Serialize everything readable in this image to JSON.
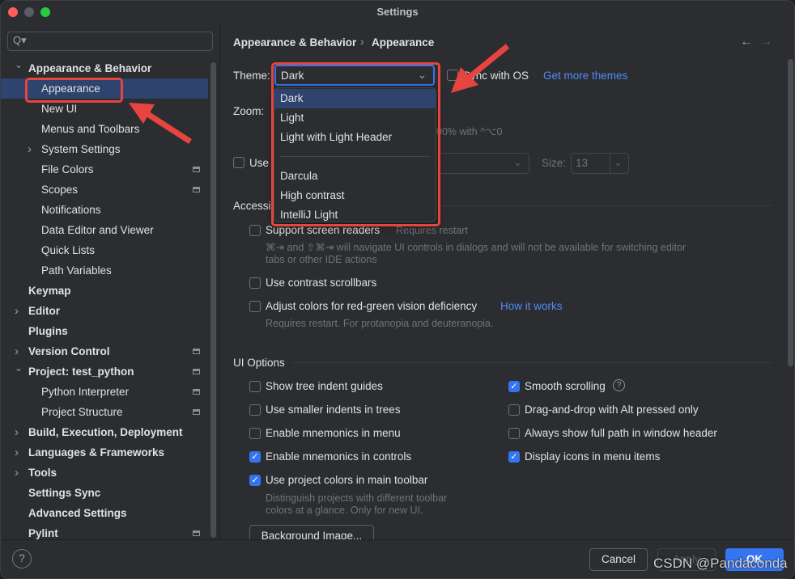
{
  "window": {
    "title": "Settings"
  },
  "sidebar": {
    "search_placeholder": "Q▾",
    "items": [
      {
        "label": "Appearance & Behavior",
        "level": 0,
        "bold": true,
        "arrow": "expanded"
      },
      {
        "label": "Appearance",
        "level": 1,
        "selected": true
      },
      {
        "label": "New UI",
        "level": 1
      },
      {
        "label": "Menus and Toolbars",
        "level": 1
      },
      {
        "label": "System Settings",
        "level": 1,
        "arrow": "collapsed"
      },
      {
        "label": "File Colors",
        "level": 1,
        "badge": true
      },
      {
        "label": "Scopes",
        "level": 1,
        "badge": true
      },
      {
        "label": "Notifications",
        "level": 1
      },
      {
        "label": "Data Editor and Viewer",
        "level": 1
      },
      {
        "label": "Quick Lists",
        "level": 1
      },
      {
        "label": "Path Variables",
        "level": 1
      },
      {
        "label": "Keymap",
        "level": 0,
        "bold": true
      },
      {
        "label": "Editor",
        "level": 0,
        "bold": true,
        "arrow": "collapsed"
      },
      {
        "label": "Plugins",
        "level": 0,
        "bold": true
      },
      {
        "label": "Version Control",
        "level": 0,
        "bold": true,
        "arrow": "collapsed",
        "badge": true
      },
      {
        "label": "Project: test_python",
        "level": 0,
        "bold": true,
        "arrow": "expanded",
        "badge": true
      },
      {
        "label": "Python Interpreter",
        "level": 1,
        "badge": true
      },
      {
        "label": "Project Structure",
        "level": 1,
        "badge": true
      },
      {
        "label": "Build, Execution, Deployment",
        "level": 0,
        "bold": true,
        "arrow": "collapsed"
      },
      {
        "label": "Languages & Frameworks",
        "level": 0,
        "bold": true,
        "arrow": "collapsed"
      },
      {
        "label": "Tools",
        "level": 0,
        "bold": true,
        "arrow": "collapsed"
      },
      {
        "label": "Settings Sync",
        "level": 0,
        "bold": true
      },
      {
        "label": "Advanced Settings",
        "level": 0,
        "bold": true
      },
      {
        "label": "Pylint",
        "level": 0,
        "bold": true,
        "badge": true
      }
    ]
  },
  "breadcrumb": {
    "parent": "Appearance & Behavior",
    "sep": "›",
    "current": "Appearance",
    "back": "←",
    "forward": "→"
  },
  "theme": {
    "label": "Theme:",
    "value": "Dark",
    "sync_label": "Sync with OS",
    "get_more": "Get more themes",
    "options_group1": [
      "Dark",
      "Light",
      "Light with Light Header"
    ],
    "options_group2": [
      "Darcula",
      "High contrast",
      "IntelliJ Light"
    ]
  },
  "zoom": {
    "label": "Zoom:",
    "hint": "00% with ^⌥0"
  },
  "font": {
    "use_label": "Use",
    "size_label": "Size:",
    "size_value": "13"
  },
  "accessibility": {
    "heading": "Accessibility",
    "screen_readers": "Support screen readers",
    "screen_readers_note": "Requires restart",
    "screen_readers_desc1": "⌘⇥ and ⇧⌘⇥ will navigate UI controls in dialogs and will not be available for switching editor",
    "screen_readers_desc2": "tabs or other IDE actions",
    "contrast_scrollbars": "Use contrast scrollbars",
    "red_green": "Adjust colors for red-green vision deficiency",
    "how_it_works": "How it works",
    "red_green_desc": "Requires restart. For protanopia and deuteranopia."
  },
  "ui_options": {
    "heading": "UI Options",
    "left": [
      {
        "label": "Show tree indent guides",
        "checked": false
      },
      {
        "label": "Use smaller indents in trees",
        "checked": false
      },
      {
        "label": "Enable mnemonics in menu",
        "checked": false
      },
      {
        "label": "Enable mnemonics in controls",
        "checked": true
      },
      {
        "label": "Use project colors in main toolbar",
        "checked": true
      }
    ],
    "right": [
      {
        "label": "Smooth scrolling",
        "checked": true
      },
      {
        "label": "Drag-and-drop with Alt pressed only",
        "checked": false
      },
      {
        "label": "Always show full path in window header",
        "checked": false
      },
      {
        "label": "Display icons in menu items",
        "checked": true
      }
    ],
    "project_colors_desc1": "Distinguish projects with different toolbar",
    "project_colors_desc2": "colors at a glance. Only for new UI.",
    "background_image": "Background Image..."
  },
  "footer": {
    "help": "?",
    "cancel": "Cancel",
    "apply": "Apply",
    "ok": "OK"
  },
  "watermark": "CSDN @Pandaconda",
  "colors": {
    "accent": "#3574f0",
    "selection": "#2e436e",
    "annotation": "#e8443f",
    "link": "#548af7"
  }
}
